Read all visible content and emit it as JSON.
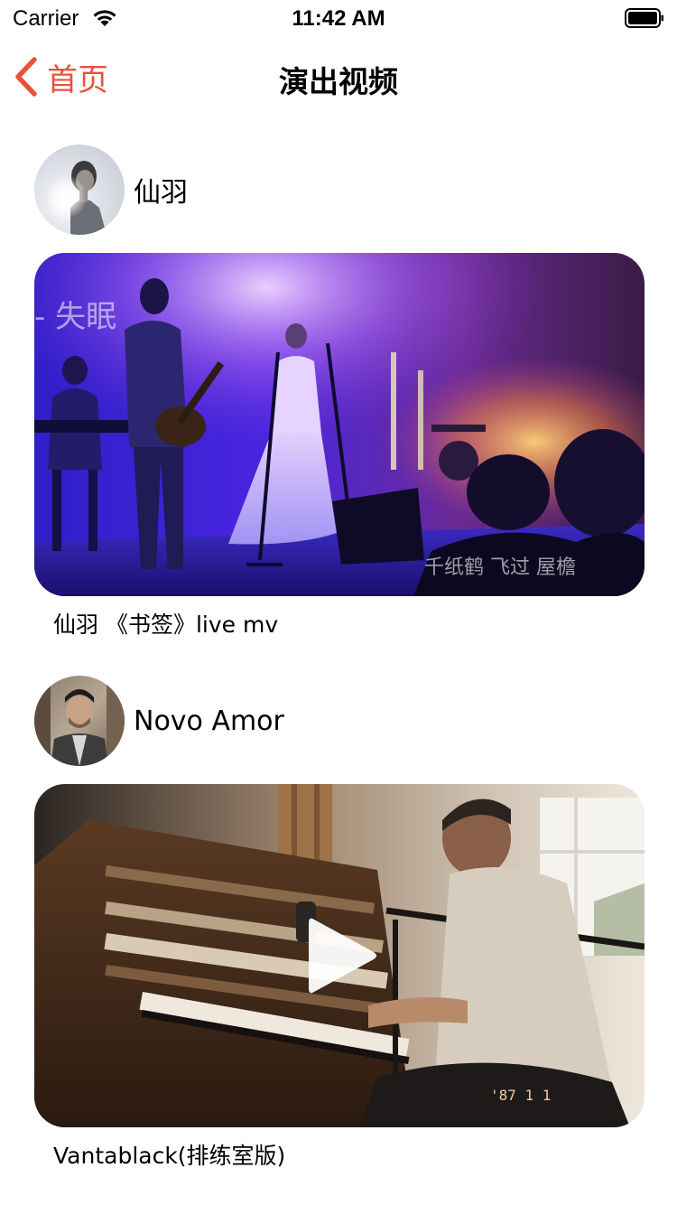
{
  "status_bar": {
    "carrier": "Carrier",
    "time": "11:42 AM"
  },
  "nav": {
    "back_label": "首页",
    "title": "演出视频",
    "accent_color": "#e8523a"
  },
  "posts": [
    {
      "author": "仙羽",
      "video_caption": "仙羽 《书签》live mv",
      "overlay_subtitle": "千纸鹤 飞过 屋檐"
    },
    {
      "author": "Novo Amor",
      "video_caption": "Vantablack(排练室版)",
      "overlay_datestamp": "'87 1 1"
    }
  ]
}
